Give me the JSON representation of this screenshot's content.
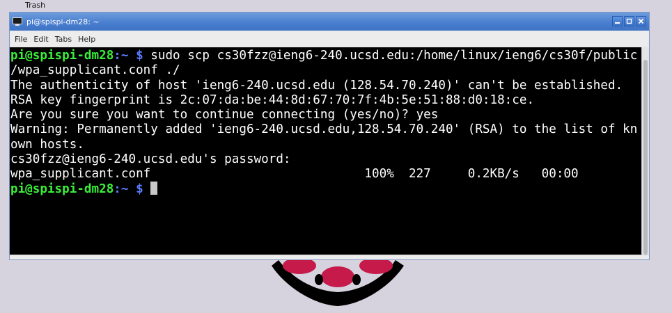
{
  "desktop": {
    "trash_label": "Trash"
  },
  "window": {
    "title": "pi@spispi-dm28: ~"
  },
  "menu": [
    "File",
    "Edit",
    "Tabs",
    "Help"
  ],
  "terminal": {
    "lines": [
      {
        "user": "pi@spispi-dm28",
        "path": ":~ $",
        "text": " sudo scp cs30fzz@ieng6-240.ucsd.edu:/home/linux/ieng6/cs30f/public"
      },
      {
        "text": "/wpa_supplicant.conf ./"
      },
      {
        "text": "The authenticity of host 'ieng6-240.ucsd.edu (128.54.70.240)' can't be established."
      },
      {
        "text": "RSA key fingerprint is 2c:07:da:be:44:8d:67:70:7f:4b:5e:51:88:d0:18:ce."
      },
      {
        "text": "Are you sure you want to continue connecting (yes/no)? yes"
      },
      {
        "text": "Warning: Permanently added 'ieng6-240.ucsd.edu,128.54.70.240' (RSA) to the list of kn"
      },
      {
        "text": "own hosts."
      },
      {
        "text": "cs30fzz@ieng6-240.ucsd.edu's password:"
      },
      {
        "text": "wpa_supplicant.conf                             100%  227     0.2KB/s   00:00"
      },
      {
        "user": "pi@spispi-dm28",
        "path": ":~ $",
        "text": " ",
        "cursor": true
      }
    ]
  },
  "colors": {
    "prompt_user": "#3aef3a",
    "prompt_path": "#5b7cff",
    "titlebar": "#4a7fd0",
    "logo": "#c51a4a"
  }
}
